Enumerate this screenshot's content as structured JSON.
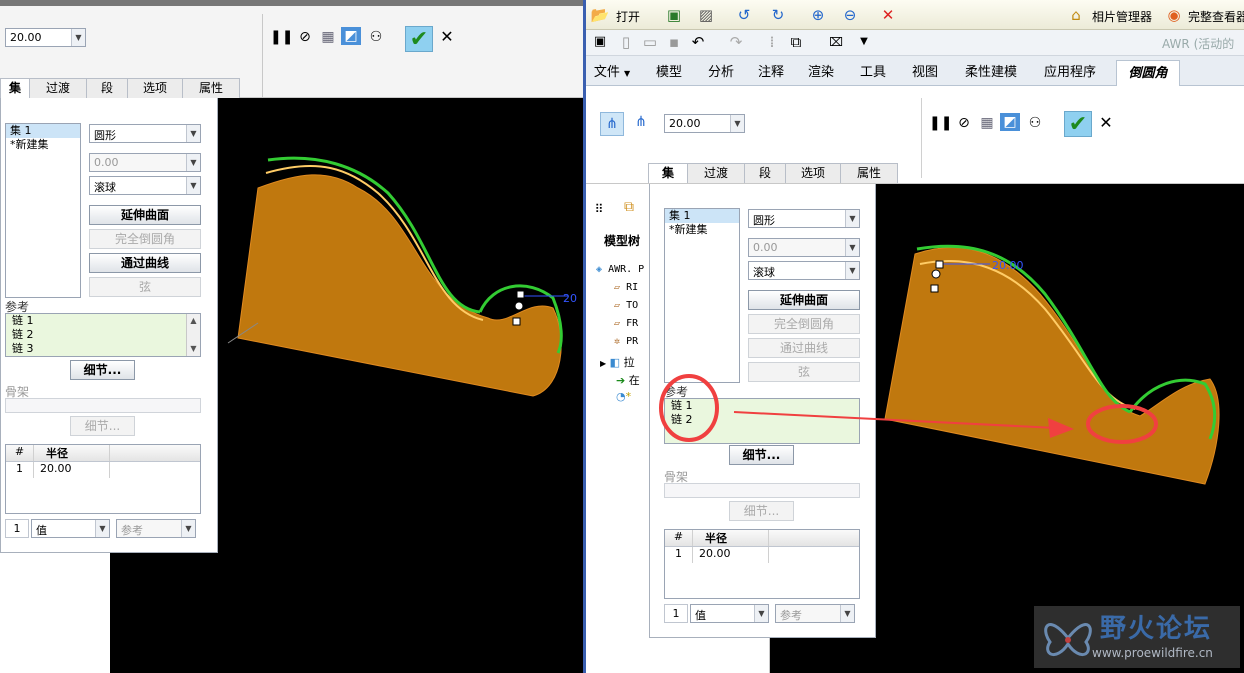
{
  "left": {
    "radius_dropdown": "20.00",
    "tabs": [
      "集",
      "过渡",
      "段",
      "选项",
      "属性"
    ],
    "sets": [
      "集 1",
      "*新建集"
    ],
    "shape_dropdown": "圆形",
    "value_dropdown": "0.00",
    "rolling_dropdown": "滚球",
    "buttons": {
      "extend": "延伸曲面",
      "full_round": "完全倒圆角",
      "through_curve": "通过曲线",
      "chord": "弦"
    },
    "reference_label": "参考",
    "references": [
      "链 1",
      "链 2",
      "链 3"
    ],
    "details_button": "细节...",
    "skeleton_label": "骨架",
    "skeleton_details": "细节...",
    "table": {
      "headers": [
        "#",
        "半径"
      ],
      "rows": [
        [
          "1",
          "20.00"
        ]
      ]
    },
    "bottom_index": "1",
    "bottom_value": "值",
    "bottom_ref": "参考",
    "dim_label": "20"
  },
  "right": {
    "top_toolbar": {
      "open": "打开",
      "photo_manager": "相片管理器",
      "full_view": "完整查看器"
    },
    "window_title": "AWR (活动的",
    "ribbon_tabs": [
      "文件",
      "模型",
      "分析",
      "注释",
      "渲染",
      "工具",
      "视图",
      "柔性建模",
      "应用程序",
      "倒圆角"
    ],
    "radius_dropdown": "20.00",
    "tabs": [
      "集",
      "过渡",
      "段",
      "选项",
      "属性"
    ],
    "sets": [
      "集 1",
      "*新建集"
    ],
    "shape_dropdown": "圆形",
    "value_dropdown": "0.00",
    "rolling_dropdown": "滚球",
    "buttons": {
      "extend": "延伸曲面",
      "full_round": "完全倒圆角",
      "through_curve": "通过曲线",
      "chord": "弦"
    },
    "reference_label": "参考",
    "references": [
      "链 1",
      "链 2"
    ],
    "details_button": "细节...",
    "skeleton_label": "骨架",
    "skeleton_details": "细节...",
    "table": {
      "headers": [
        "#",
        "半径"
      ],
      "rows": [
        [
          "1",
          "20.00"
        ]
      ]
    },
    "bottom_index": "1",
    "bottom_value": "值",
    "bottom_ref": "参考",
    "model_tree_label": "模型树",
    "tree_items": [
      "AWR. P",
      "RI",
      "TO",
      "FR",
      "PR",
      "拉",
      "在",
      "*"
    ],
    "dim_label": "20.00"
  },
  "watermark": {
    "title": "野火论坛",
    "url": "www.proewildfire.cn"
  },
  "colors": {
    "model_orange": "#c0780e",
    "edge_green": "#33cc33",
    "annotation_red": "#f04040",
    "accept_green": "#2ea82e"
  }
}
